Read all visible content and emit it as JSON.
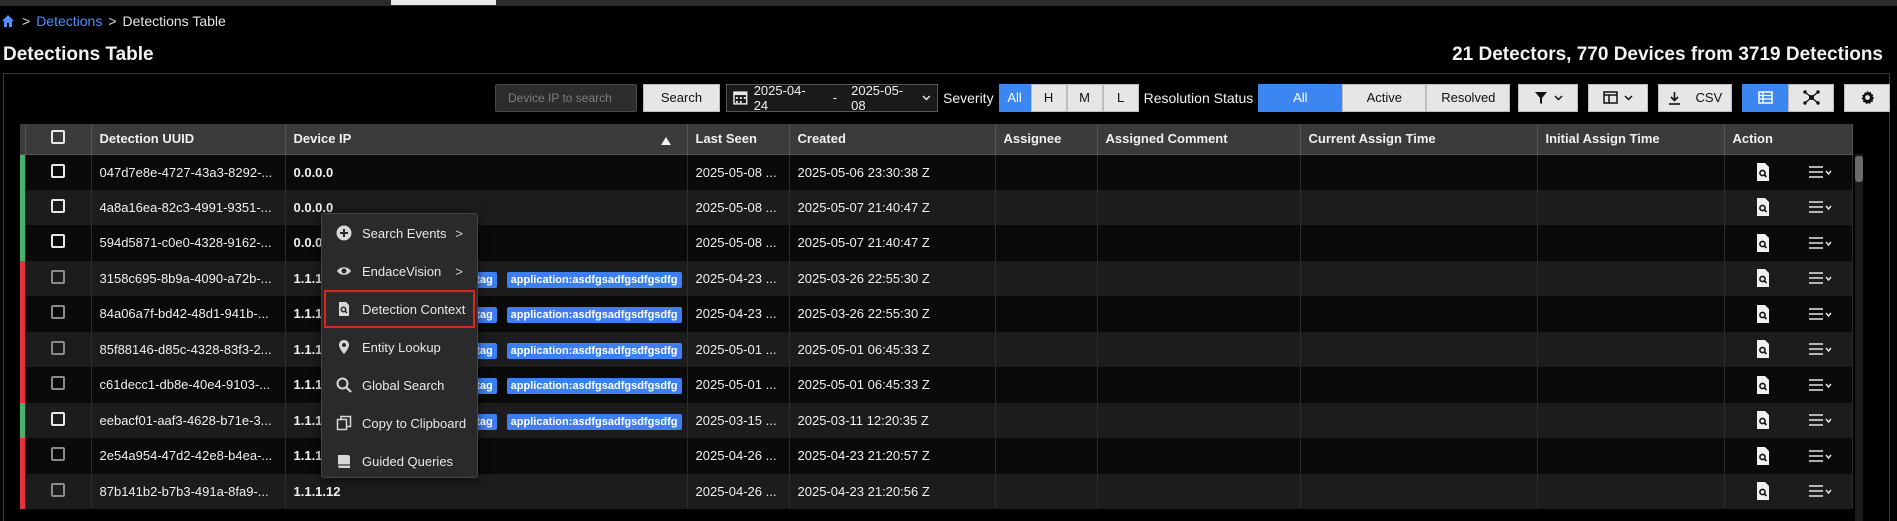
{
  "breadcrumb": {
    "link": "Detections",
    "sep": ">",
    "current": "Detections Table"
  },
  "page": {
    "title": "Detections Table",
    "summary": "21 Detectors, 770 Devices from 3719 Detections"
  },
  "toolbar": {
    "search_placeholder": "Device IP to search",
    "search_label": "Search",
    "date_start": "2025-04-24",
    "date_sep": "-",
    "date_end": "2025-05-08",
    "severity_label": "Severity",
    "severity_options": [
      "All",
      "H",
      "M",
      "L"
    ],
    "resolution_label": "Resolution Status",
    "resolution_options": [
      "All",
      "Active",
      "Resolved"
    ],
    "csv_label": "CSV"
  },
  "columns": [
    "Detection UUID",
    "Device IP",
    "Last Seen",
    "Created",
    "Assignee",
    "Assigned Comment",
    "Current Assign Time",
    "Initial Assign Time",
    "Action"
  ],
  "rows": [
    {
      "uuid": "047d7e8e-4727-43a3-8292-...",
      "ip": "0.0.0.0",
      "last_seen": "2025-05-08 ...",
      "created": "2025-05-06 23:30:38 Z",
      "tag1": "",
      "tag2": ""
    },
    {
      "uuid": "4a8a16ea-82c3-4991-9351-...",
      "ip": "0.0.0.0",
      "last_seen": "2025-05-08 ...",
      "created": "2025-05-07 21:40:47 Z",
      "tag1": "",
      "tag2": ""
    },
    {
      "uuid": "594d5871-c0e0-4328-9162-...",
      "ip": "0.0.0",
      "last_seen": "2025-05-08 ...",
      "created": "2025-05-07 21:40:47 Z",
      "tag1": "",
      "tag2": ""
    },
    {
      "uuid": "3158c695-8b9a-4090-a72b-...",
      "ip": "1.1.1",
      "last_seen": "2025-04-23 ...",
      "created": "2025-03-26 22:55:30 Z",
      "tag1": ":tag",
      "tag2": "application:asdfgsadfgsdfgsdfg"
    },
    {
      "uuid": "84a06a7f-bd42-48d1-941b-...",
      "ip": "1.1.1",
      "last_seen": "2025-04-23 ...",
      "created": "2025-03-26 22:55:30 Z",
      "tag1": ":tag",
      "tag2": "application:asdfgsadfgsdfgsdfg"
    },
    {
      "uuid": "85f88146-d85c-4328-83f3-2...",
      "ip": "1.1.1",
      "last_seen": "2025-05-01 ...",
      "created": "2025-05-01 06:45:33 Z",
      "tag1": ":tag",
      "tag2": "application:asdfgsadfgsdfgsdfg"
    },
    {
      "uuid": "c61decc1-db8e-40e4-9103-...",
      "ip": "1.1.1",
      "last_seen": "2025-05-01 ...",
      "created": "2025-05-01 06:45:33 Z",
      "tag1": ":tag",
      "tag2": "application:asdfgsadfgsdfgsdfg"
    },
    {
      "uuid": "eebacf01-aaf3-4628-b71e-3...",
      "ip": "1.1.1",
      "last_seen": "2025-03-15 ...",
      "created": "2025-03-11 12:20:35 Z",
      "tag1": ":tag",
      "tag2": "application:asdfgsadfgsdfgsdfg"
    },
    {
      "uuid": "2e54a954-47d2-42e8-b4ea-...",
      "ip": "1.1.1",
      "last_seen": "2025-04-26 ...",
      "created": "2025-04-23 21:20:57 Z",
      "tag1": "",
      "tag2": ""
    },
    {
      "uuid": "87b141b2-b7b3-491a-8fa9-...",
      "ip": "1.1.1.12",
      "last_seen": "2025-04-26 ...",
      "created": "2025-04-23 21:20:56 Z",
      "tag1": "",
      "tag2": ""
    }
  ],
  "context_menu": {
    "items": [
      "Search Events",
      "EndaceVision",
      "Detection Context",
      "Entity Lookup",
      "Global Search",
      "Copy to Clipboard",
      "Guided Queries"
    ],
    "chevron": ">"
  },
  "colors": {
    "accent": "#3b86f0",
    "stripe_green": "#4caf70",
    "stripe_red": "#e0333b",
    "highlight": "#d9261c"
  }
}
